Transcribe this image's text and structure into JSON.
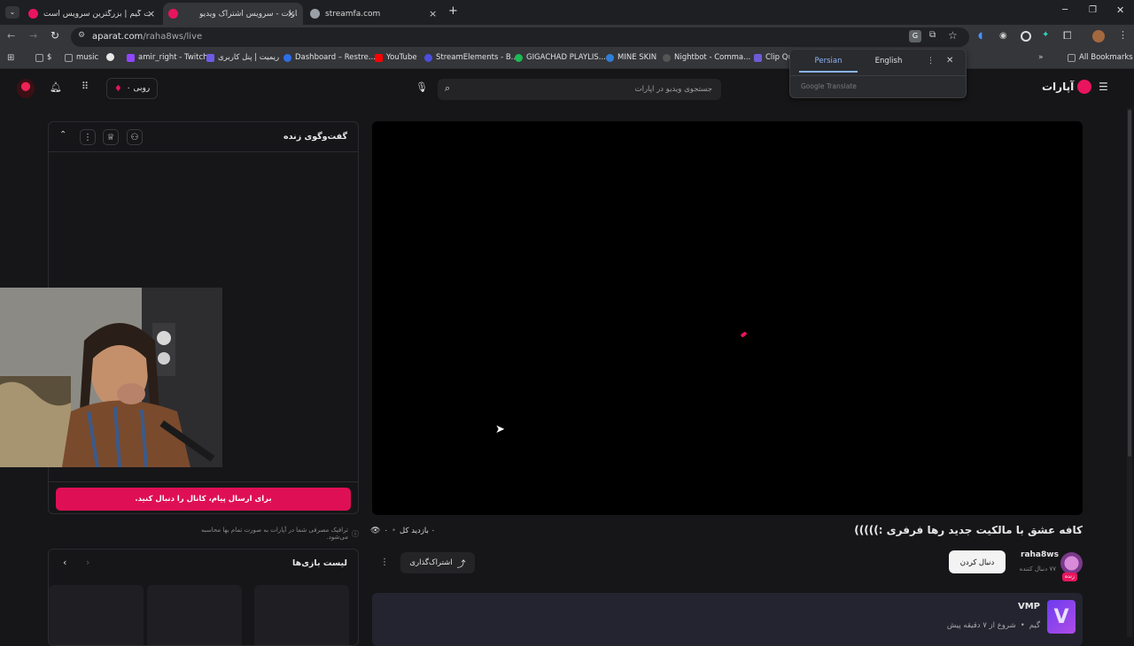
{
  "browser": {
    "tabs": [
      {
        "title": "آپارات گیم | بزرگترین سرویس است",
        "active": false
      },
      {
        "title": "آپارات - سرویس اشتراک ویدیو",
        "active": true
      },
      {
        "title": "streamfa.com",
        "active": false
      }
    ],
    "new_tab": "+",
    "url_host": "aparat.com",
    "url_path": "/raha8ws/live",
    "bookmarks": [
      {
        "label": "$",
        "color": "#9aa0a6"
      },
      {
        "label": "music",
        "color": "#9aa0a6"
      },
      {
        "label": "",
        "color": "#e8e8e8"
      },
      {
        "label": "amir_right - Twitch",
        "color": "#9146ff"
      },
      {
        "label": "ریمیت | پنل کاربری",
        "color": "#6c5ce7"
      },
      {
        "label": "Dashboard – Restre...",
        "color": "#2d6fe8"
      },
      {
        "label": "YouTube",
        "color": "#ff0000"
      },
      {
        "label": "StreamElements - B...",
        "color": "#4a4fe0"
      },
      {
        "label": "GIGACHAD PLAYLIS...",
        "color": "#1db954"
      },
      {
        "label": "MINE SKIN",
        "color": "#2f7fd8"
      },
      {
        "label": "Nightbot - Comma...",
        "color": "#222"
      },
      {
        "label": "Clip Qu",
        "color": "#6e5bd8"
      }
    ],
    "all_bookmarks": "All Bookmarks"
  },
  "translate_popup": {
    "tabs": [
      "Persian",
      "English"
    ],
    "footer": "Google Translate"
  },
  "header": {
    "logo_text": "آپارات",
    "search_placeholder": "جستجوی ویدیو در آپارات",
    "ruby_label": "۰ روبی"
  },
  "chat": {
    "title": "گفت‌وگوی زنده",
    "follow_prompt": "برای ارسال پیام، کانال را دنبال کنید.",
    "traffic_note": "ترافیک مصرفی شما در آپارات به صورت تمام بها محاسبه می‌شود."
  },
  "games": {
    "title": "لیست بازی‌ها"
  },
  "video": {
    "title": "کافه عشق با مالکیت جدید رها فرفری :)))))",
    "views": "۰ بازدید کل",
    "views_dot": "۰"
  },
  "channel": {
    "name": "raha8ws",
    "followers": "۷۷ دنبال کننده",
    "live_badge": "زنده",
    "follow_button": "دنبال کردن",
    "share_button": "اشتراک‌گذاری"
  },
  "game_card": {
    "name": "VMP",
    "category": "گیم",
    "started": "شروع از ۷ دقیقه پیش"
  },
  "colors": {
    "accent": "#df0f55",
    "background": "#161618"
  }
}
